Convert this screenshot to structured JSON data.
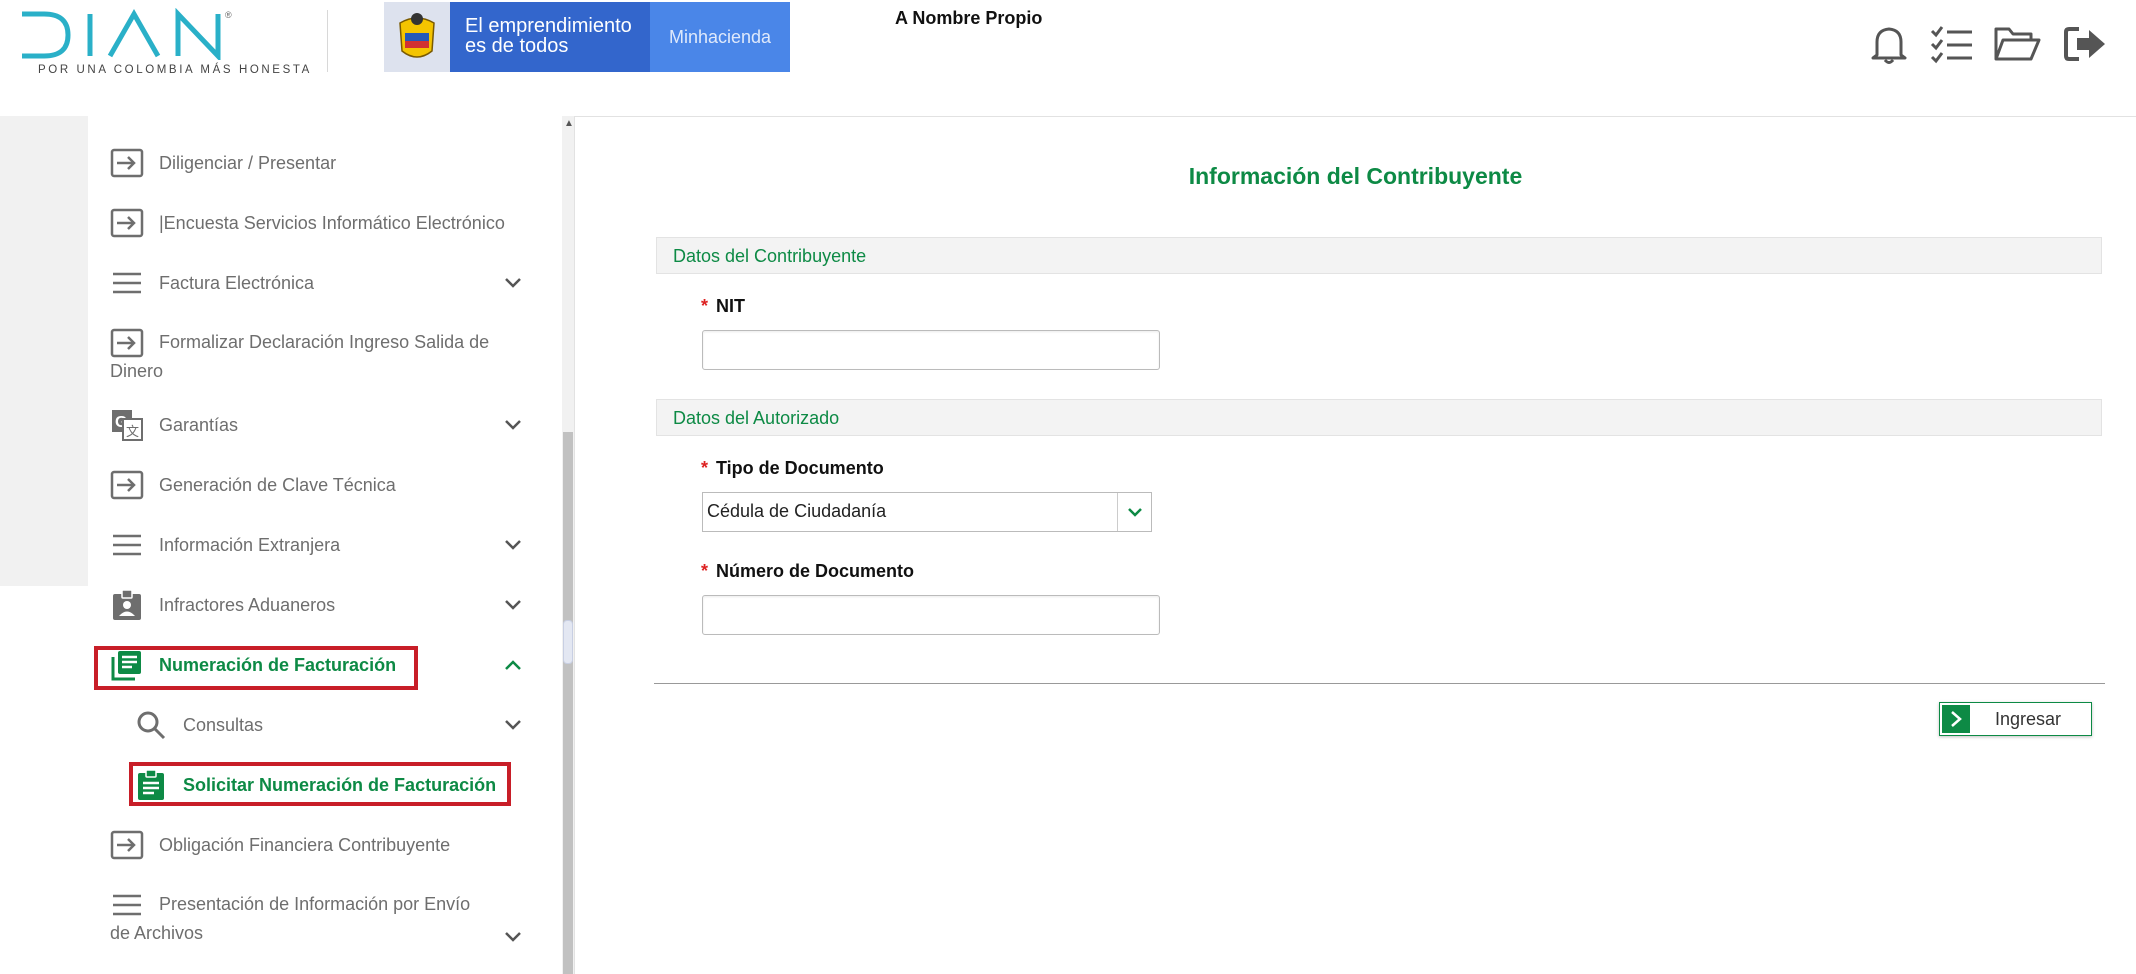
{
  "header": {
    "logo_text": "DIAN",
    "logo_tagline": "POR UNA COLOMBIA MÁS HONESTA",
    "gov_slogan_line1": "El emprendimiento",
    "gov_slogan_line2": "es de todos",
    "gov_ministry": "Minhacienda",
    "user_name": "A Nombre Propio",
    "icons": [
      "bell-icon",
      "checklist-icon",
      "folder-open-icon",
      "sign-out-icon"
    ]
  },
  "sidebar": {
    "items": [
      {
        "label": "Diligenciar / Presentar",
        "icon": "arrow-in-icon"
      },
      {
        "label": "|Encuesta Servicios Informático Electrónico",
        "icon": "arrow-in-icon"
      },
      {
        "label": "Factura Electrónica",
        "icon": "menu-icon",
        "expand": "down"
      },
      {
        "label": "Formalizar Declaración Ingreso Salida de Dinero",
        "icon": "arrow-in-icon"
      },
      {
        "label": "Garantías",
        "icon": "translate-icon",
        "expand": "down"
      },
      {
        "label": "Generación de Clave Técnica",
        "icon": "arrow-in-icon"
      },
      {
        "label": "Información Extranjera",
        "icon": "menu-icon",
        "expand": "down"
      },
      {
        "label": "Infractores Aduaneros",
        "icon": "badge-icon",
        "expand": "down"
      },
      {
        "label": "Numeración de Facturación",
        "icon": "document-list-icon",
        "expand": "up",
        "active": true
      },
      {
        "label": "Consultas",
        "icon": "search-icon",
        "expand": "down"
      },
      {
        "label": "Solicitar Numeración de Facturación",
        "icon": "clipboard-icon",
        "active": true
      },
      {
        "label": "Obligación Financiera Contribuyente",
        "icon": "arrow-in-icon"
      },
      {
        "label": "Presentación de Información por Envío de Archivos",
        "icon": "menu-icon",
        "expand": "down"
      }
    ]
  },
  "main": {
    "title": "Información del Contribuyente",
    "section1": "Datos del Contribuyente",
    "nit_label": "NIT",
    "nit_value": "",
    "section2": "Datos del Autorizado",
    "tipo_doc_label": "Tipo de Documento",
    "tipo_doc_value": "Cédula de Ciudadanía",
    "numero_doc_label": "Número de Documento",
    "numero_doc_value": "",
    "required_mark": "*",
    "submit_label": "Ingresar"
  },
  "colors": {
    "brand_green": "#0d8a45",
    "dian_blue": "#2ab0c8",
    "highlight_red": "#c81e28",
    "gov_blue": "#3366cc"
  }
}
